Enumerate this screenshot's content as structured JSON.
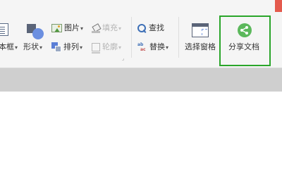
{
  "ribbon": {
    "textbox": {
      "label": "本框",
      "caret": "▾"
    },
    "shapes": {
      "label": "形状",
      "caret": "▾"
    },
    "picture": {
      "label": "图片",
      "caret": "▾"
    },
    "arrange": {
      "label": "排列",
      "caret": "▾"
    },
    "fill": {
      "label": "填充",
      "caret": "▾"
    },
    "outline": {
      "label": "轮廓",
      "caret": "▾"
    },
    "group_launcher": "⌟",
    "find": {
      "label": "查找"
    },
    "replace": {
      "label": "替换",
      "caret": "▾"
    },
    "selection_pane": {
      "label": "选择窗格"
    },
    "share_document": {
      "label": "分享文档",
      "highlight_color": "#2aa52a",
      "icon_color": "#5cb85c"
    }
  },
  "icons": {
    "textbox": "text-box-icon",
    "shapes": "shapes-icon",
    "picture": "picture-icon",
    "arrange": "arrange-icon",
    "fill": "fill-bucket-icon",
    "outline": "outline-icon",
    "find": "search-icon",
    "replace": "replace-icon",
    "selection_pane": "selection-pane-icon",
    "share": "share-icon"
  },
  "colors": {
    "ribbon_bg": "#f5f5f5",
    "accent_red": "#e45a4d",
    "content_band": "#cfcfcf"
  }
}
